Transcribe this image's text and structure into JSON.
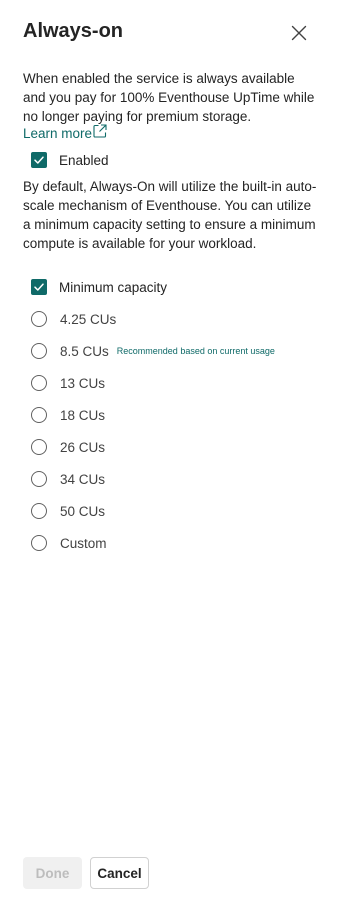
{
  "dialog": {
    "title": "Always-on",
    "description": "When enabled the service is always available and you pay for 100% Eventhouse UpTime while no longer paying for premium storage.",
    "learn_more": "Learn more",
    "enabled_label": "Enabled",
    "enabled_checked": true,
    "description2": "By default, Always-On will utilize the built-in auto-scale mechanism of Eventhouse. You can utilize a minimum capacity setting to ensure a minimum compute is available for your workload.",
    "minimum_capacity_label": "Minimum capacity",
    "minimum_capacity_checked": true,
    "options": [
      {
        "label": "4.25 CUs",
        "note": ""
      },
      {
        "label": "8.5 CUs",
        "note": "Recommended based on current usage"
      },
      {
        "label": "13 CUs",
        "note": ""
      },
      {
        "label": "18 CUs",
        "note": ""
      },
      {
        "label": "26 CUs",
        "note": ""
      },
      {
        "label": "34 CUs",
        "note": ""
      },
      {
        "label": "50 CUs",
        "note": ""
      },
      {
        "label": "Custom",
        "note": ""
      }
    ],
    "done_label": "Done",
    "cancel_label": "Cancel",
    "accent_color": "#0f6a68"
  }
}
